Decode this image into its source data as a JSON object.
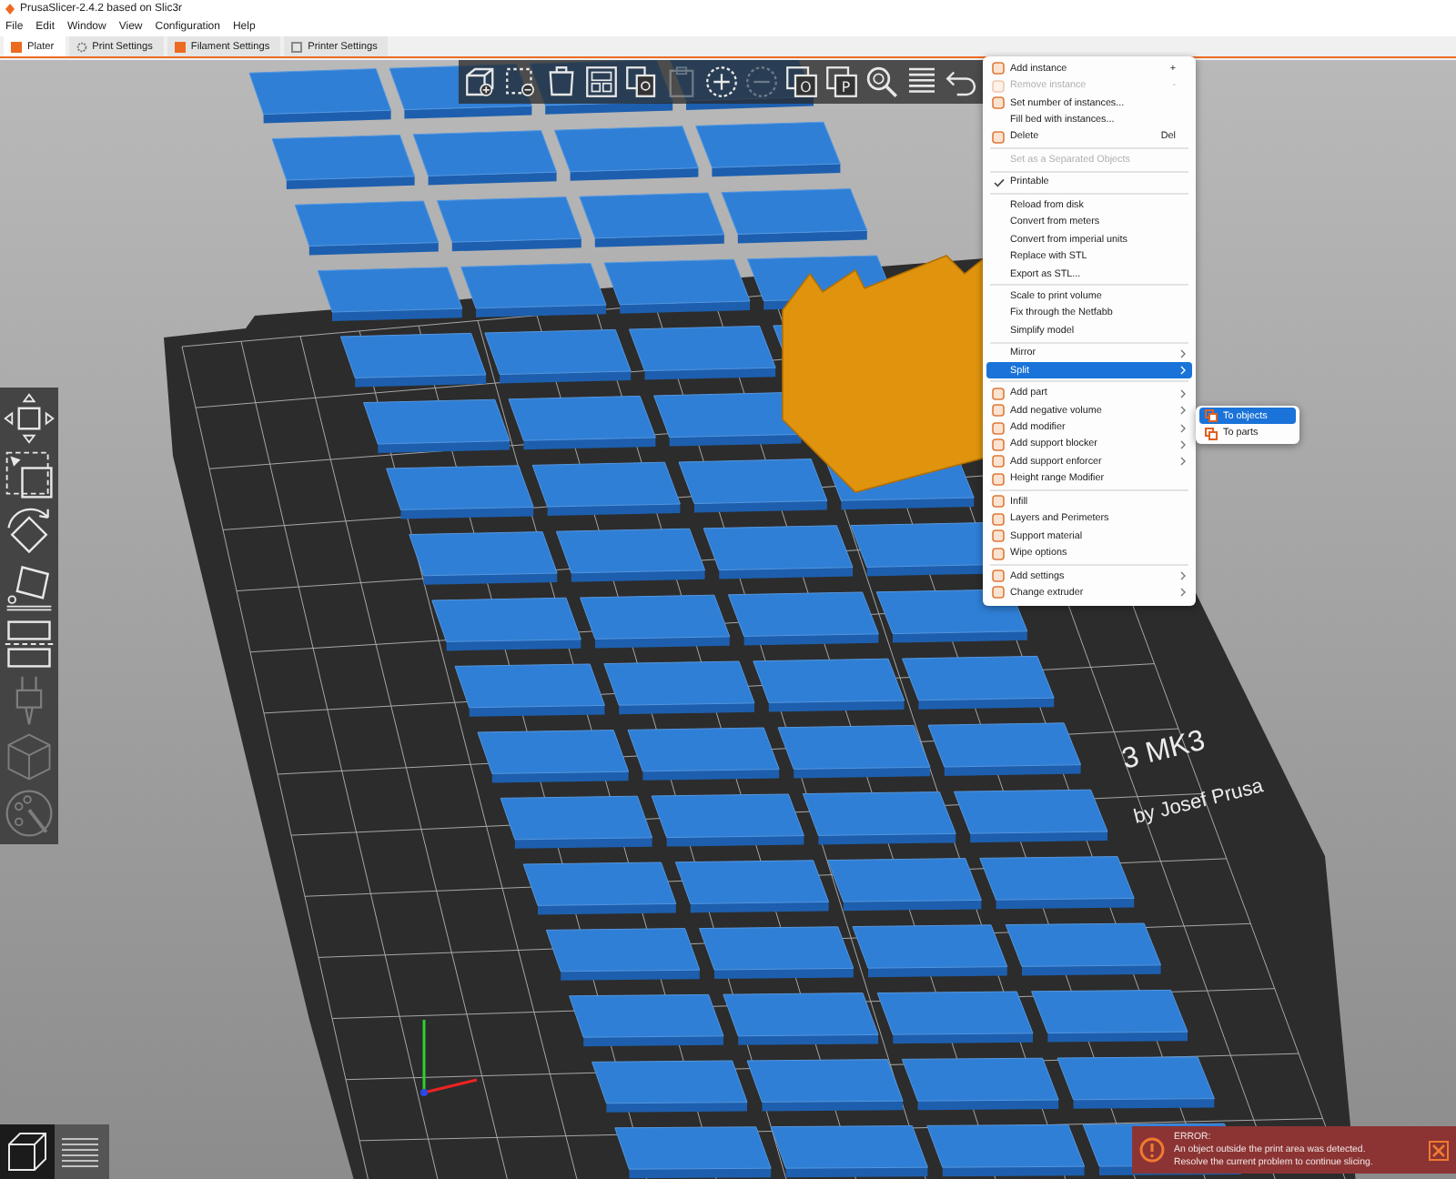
{
  "window": {
    "title": "PrusaSlicer-2.4.2 based on Slic3r"
  },
  "menu_bar": [
    "File",
    "Edit",
    "Window",
    "View",
    "Configuration",
    "Help"
  ],
  "tabs": [
    {
      "label": "Plater",
      "selected": true,
      "kind": "plater"
    },
    {
      "label": "Print Settings",
      "selected": false,
      "kind": "print"
    },
    {
      "label": "Filament Settings",
      "selected": false,
      "kind": "filament"
    },
    {
      "label": "Printer Settings",
      "selected": false,
      "kind": "printer"
    }
  ],
  "toolbar": [
    {
      "kind": "add",
      "disabled": false
    },
    {
      "kind": "delete",
      "disabled": false
    },
    {
      "kind": "delete_all",
      "disabled": false
    },
    {
      "kind": "arrange",
      "disabled": false
    },
    {
      "kind": "copy",
      "disabled": false
    },
    {
      "kind": "paste",
      "disabled": true
    },
    {
      "kind": "add_instance",
      "disabled": false
    },
    {
      "kind": "remove_instance",
      "disabled": true
    },
    {
      "kind": "split_objects",
      "label": "O",
      "disabled": false
    },
    {
      "kind": "split_parts",
      "label": "P",
      "disabled": false
    },
    {
      "kind": "search",
      "disabled": false
    },
    {
      "kind": "layers",
      "disabled": false
    },
    {
      "kind": "undo",
      "disabled": false
    }
  ],
  "gizmos": [
    {
      "kind": "move",
      "disabled": false
    },
    {
      "kind": "scale",
      "disabled": false
    },
    {
      "kind": "rotate",
      "disabled": false
    },
    {
      "kind": "place",
      "disabled": false
    },
    {
      "kind": "cut",
      "disabled": false
    },
    {
      "kind": "supports",
      "disabled": true
    },
    {
      "kind": "seam",
      "disabled": true
    },
    {
      "kind": "paint",
      "disabled": true
    }
  ],
  "bed": {
    "labels": [
      "3 MK3",
      "by Josef Prusa"
    ]
  },
  "view_buttons": [
    {
      "kind": "editor",
      "selected": true
    },
    {
      "kind": "preview",
      "selected": false
    }
  ],
  "context_menu": {
    "items": [
      {
        "kind": "item",
        "label": "Add instance",
        "icon": true,
        "shortcut": "+",
        "disabled": false
      },
      {
        "kind": "item",
        "label": "Remove instance",
        "icon": true,
        "shortcut": "-",
        "disabled": true
      },
      {
        "kind": "item",
        "label": "Set number of instances...",
        "icon": true,
        "disabled": false
      },
      {
        "kind": "item",
        "label": "Fill bed with instances...",
        "disabled": false
      },
      {
        "kind": "item",
        "label": "Delete",
        "icon": true,
        "shortcut": "Del",
        "disabled": false
      },
      {
        "kind": "separator"
      },
      {
        "kind": "item",
        "label": "Set as a Separated Objects",
        "disabled": true
      },
      {
        "kind": "separator"
      },
      {
        "kind": "item",
        "label": "Printable",
        "checked": true,
        "disabled": false
      },
      {
        "kind": "separator"
      },
      {
        "kind": "item",
        "label": "Reload from disk",
        "disabled": false
      },
      {
        "kind": "item",
        "label": "Convert from meters",
        "disabled": false
      },
      {
        "kind": "item",
        "label": "Convert from imperial units",
        "disabled": false
      },
      {
        "kind": "item",
        "label": "Replace with STL",
        "disabled": false
      },
      {
        "kind": "item",
        "label": "Export as STL...",
        "disabled": false
      },
      {
        "kind": "separator"
      },
      {
        "kind": "item",
        "label": "Scale to print volume",
        "disabled": false
      },
      {
        "kind": "item",
        "label": "Fix through the Netfabb",
        "disabled": false
      },
      {
        "kind": "item",
        "label": "Simplify model",
        "disabled": false
      },
      {
        "kind": "separator"
      },
      {
        "kind": "item",
        "label": "Mirror",
        "submenu": true,
        "disabled": false
      },
      {
        "kind": "item",
        "label": "Split",
        "submenu": true,
        "selected": true,
        "disabled": false
      },
      {
        "kind": "separator"
      },
      {
        "kind": "item",
        "label": "Add part",
        "icon": true,
        "submenu": true,
        "disabled": false
      },
      {
        "kind": "item",
        "label": "Add negative volume",
        "icon": true,
        "submenu": true,
        "disabled": false
      },
      {
        "kind": "item",
        "label": "Add modifier",
        "icon": true,
        "submenu": true,
        "disabled": false
      },
      {
        "kind": "item",
        "label": "Add support blocker",
        "icon": true,
        "submenu": true,
        "disabled": false
      },
      {
        "kind": "item",
        "label": "Add support enforcer",
        "icon": true,
        "submenu": true,
        "disabled": false
      },
      {
        "kind": "item",
        "label": "Height range Modifier",
        "icon": true,
        "disabled": false
      },
      {
        "kind": "separator"
      },
      {
        "kind": "item",
        "label": "Infill",
        "icon": true,
        "disabled": false
      },
      {
        "kind": "item",
        "label": "Layers and Perimeters",
        "icon": true,
        "disabled": false
      },
      {
        "kind": "item",
        "label": "Support material",
        "icon": true,
        "disabled": false
      },
      {
        "kind": "item",
        "label": "Wipe options",
        "icon": true,
        "disabled": false
      },
      {
        "kind": "separator"
      },
      {
        "kind": "item",
        "label": "Add settings",
        "icon": true,
        "submenu": true,
        "disabled": false
      },
      {
        "kind": "item",
        "label": "Change extruder",
        "icon": true,
        "submenu": true,
        "disabled": false
      }
    ]
  },
  "submenu": {
    "items": [
      {
        "label": "To objects",
        "selected": true
      },
      {
        "label": "To parts",
        "selected": false
      }
    ]
  },
  "notification": {
    "title": "ERROR:",
    "lines": [
      "An object outside the print area was detected.",
      "Resolve the current problem to continue slicing."
    ]
  }
}
